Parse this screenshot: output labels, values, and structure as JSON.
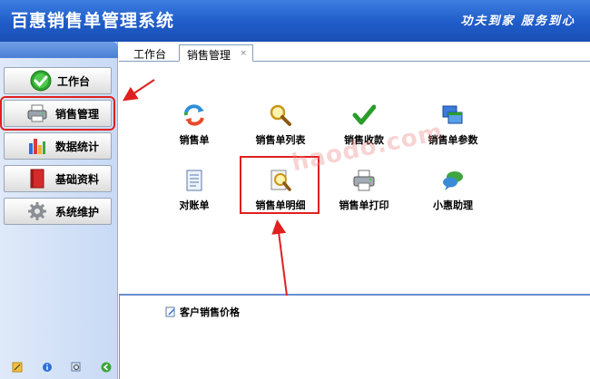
{
  "header": {
    "title": "百惠销售单管理系统",
    "slogan": "功夫到家 服务到心"
  },
  "sidebar": {
    "items": [
      {
        "label": "工作台",
        "icon": "check-circle-icon"
      },
      {
        "label": "销售管理",
        "icon": "printer-icon",
        "active": true
      },
      {
        "label": "数据统计",
        "icon": "bar-chart-icon"
      },
      {
        "label": "基础资料",
        "icon": "book-icon"
      },
      {
        "label": "系统维护",
        "icon": "gear-icon"
      }
    ],
    "bottom_icons": [
      "edit-icon",
      "info-icon",
      "search-icon",
      "back-icon"
    ]
  },
  "tabs": [
    {
      "label": "工作台"
    },
    {
      "label": "销售管理",
      "active": true,
      "close": "×"
    }
  ],
  "main": {
    "items": [
      {
        "label": "销售单",
        "icon": "recycle-icon"
      },
      {
        "label": "销售单列表",
        "icon": "magnifier-icon"
      },
      {
        "label": "销售收款",
        "icon": "checkmark-icon"
      },
      {
        "label": "销售单参数",
        "icon": "windows-icon"
      },
      {
        "label": "对账单",
        "icon": "document-icon"
      },
      {
        "label": "销售单明细",
        "icon": "detail-search-icon",
        "highlighted": true
      },
      {
        "label": "销售单打印",
        "icon": "printer-icon"
      },
      {
        "label": "小惠助理",
        "icon": "chat-icon"
      }
    ]
  },
  "watermark": "haodo.com",
  "lower": {
    "items": [
      {
        "label": "客户销售价格",
        "icon": "edit-icon"
      }
    ]
  },
  "colors": {
    "header": "#1f5cc8",
    "annotation": "#e02020",
    "sidebar": "#c8daf5"
  }
}
